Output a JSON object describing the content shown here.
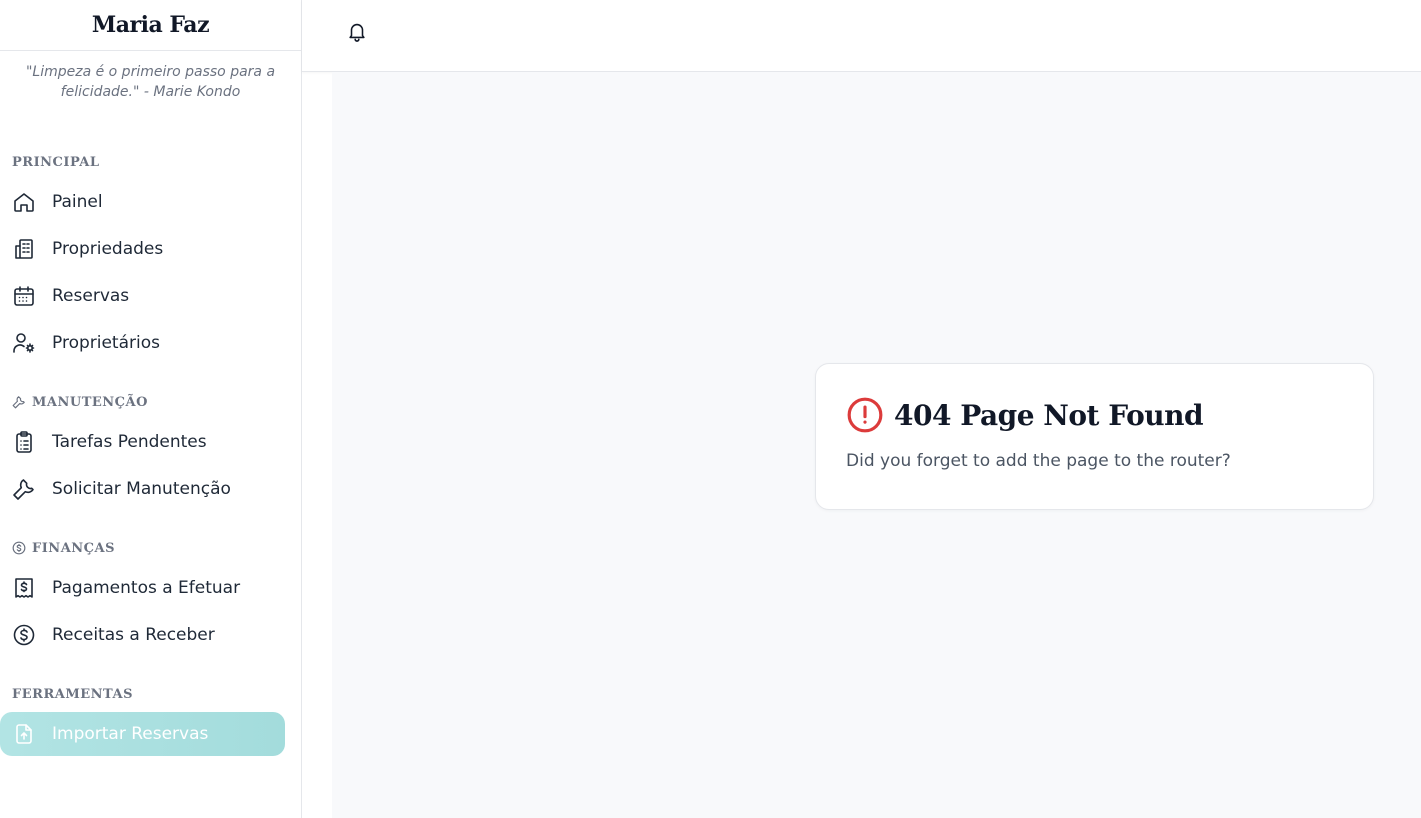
{
  "brand": "Maria Faz",
  "quote": "\"Limpeza é o primeiro passo para a felicidade.\" - Marie Kondo",
  "sections": [
    {
      "title": "PRINCIPAL",
      "icon": "",
      "items": [
        {
          "label": "Painel",
          "icon": "home-icon"
        },
        {
          "label": "Propriedades",
          "icon": "building-icon"
        },
        {
          "label": "Reservas",
          "icon": "calendar-icon"
        },
        {
          "label": "Proprietários",
          "icon": "user-gear-icon"
        }
      ]
    },
    {
      "title": "MANUTENÇÃO",
      "icon": "wrench-icon",
      "items": [
        {
          "label": "Tarefas Pendentes",
          "icon": "clipboard-icon"
        },
        {
          "label": "Solicitar Manutenção",
          "icon": "wrench-icon"
        }
      ]
    },
    {
      "title": "FINANÇAS",
      "icon": "dollar-circle-icon",
      "items": [
        {
          "label": "Pagamentos a Efetuar",
          "icon": "receipt-icon"
        },
        {
          "label": "Receitas a Receber",
          "icon": "dollar-circle-icon"
        }
      ]
    },
    {
      "title": "FERRAMENTAS",
      "icon": "",
      "items": [
        {
          "label": "Importar Reservas",
          "icon": "file-upload-icon",
          "active": true
        }
      ]
    }
  ],
  "topbar": {
    "notifications_icon": "bell-icon"
  },
  "error_card": {
    "title": "404 Page Not Found",
    "message": "Did you forget to add the page to the router?",
    "icon": "alert-circle-icon",
    "icon_color": "#dc3b3b"
  },
  "colors": {
    "active_bg": "#a8dfdf",
    "background": "#f8f9fb",
    "text": "#1f2937",
    "muted": "#6b7280"
  }
}
